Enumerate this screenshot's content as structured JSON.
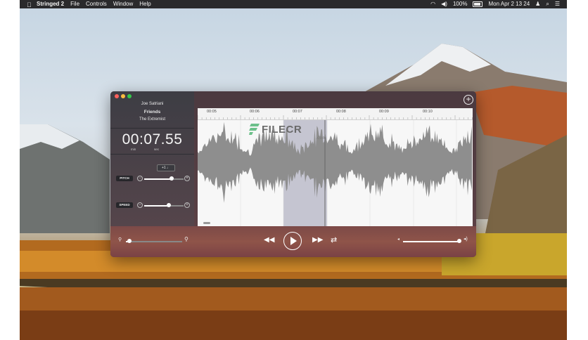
{
  "menubar": {
    "app_name": "Stringed 2",
    "items": [
      "File",
      "Controls",
      "Window",
      "Help"
    ],
    "battery": "100%",
    "clock": "Mon Apr 2  13 24"
  },
  "song": {
    "artist": "Joe Satriani",
    "title": "Friends",
    "album": "The Extremist"
  },
  "timer": {
    "value": "00:07.55",
    "min_label": "min",
    "sec_label": "sec"
  },
  "pitch": {
    "label": "PITCH",
    "semitone": "+1 ♩",
    "level": 0.7
  },
  "speed": {
    "label": "SPEED",
    "level": 0.62
  },
  "ruler": {
    "ticks": [
      "00:05",
      "00:06",
      "00:07",
      "00:08",
      "00:09",
      "00:10"
    ]
  },
  "zoom": {
    "level": 0.06
  },
  "volume": {
    "level": 0.97
  },
  "watermark": {
    "text": "FILECR",
    "suffix": ".com"
  },
  "colors": {
    "accent": "#7c4a48",
    "selection": "#b9b9c5",
    "waveform": "#8e8e8e"
  }
}
